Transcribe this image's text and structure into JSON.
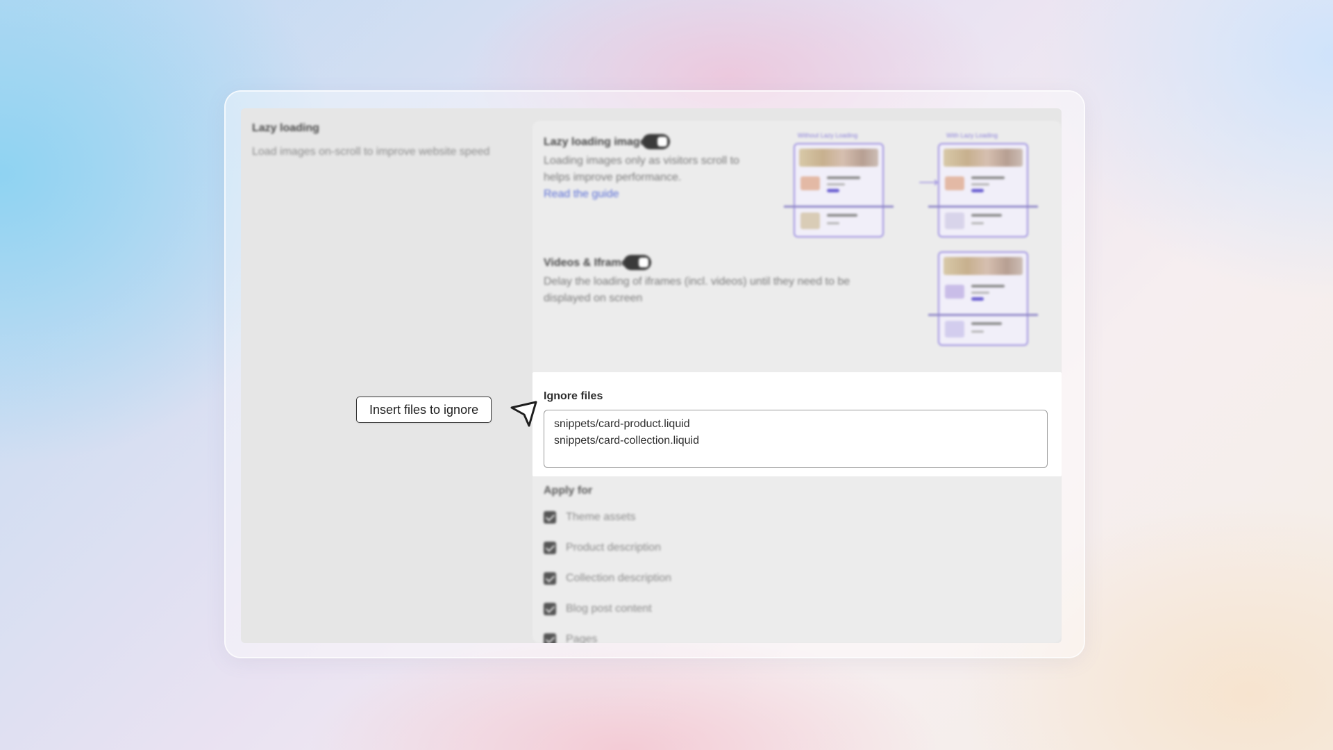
{
  "section": {
    "title": "Lazy loading",
    "description": "Load images on-scroll to improve website speed"
  },
  "lazy_images": {
    "title": "Lazy loading images",
    "enabled": true,
    "description_line1": "Loading images only as visitors scroll to",
    "description_line2": "helps improve performance.",
    "link": "Read the guide",
    "illustration_before": "Without Lazy Loading",
    "illustration_after": "With Lazy Loading"
  },
  "videos": {
    "title": "Videos & Iframes",
    "enabled": true,
    "description_line1": "Delay the loading of iframes (incl. videos) until they need to be",
    "description_line2": "displayed on screen"
  },
  "ignore_files": {
    "label": "Ignore files",
    "value": "snippets/card-product.liquid\nsnippets/card-collection.liquid"
  },
  "apply_for": {
    "title": "Apply for",
    "options": [
      {
        "label": "Theme assets",
        "checked": true
      },
      {
        "label": "Product description",
        "checked": true
      },
      {
        "label": "Collection description",
        "checked": true
      },
      {
        "label": "Blog post content",
        "checked": true
      },
      {
        "label": "Pages",
        "checked": true
      }
    ]
  },
  "callout": {
    "text": "Insert files to ignore"
  },
  "icons": {
    "cursor": "cursor-arrow-icon",
    "flow_arrow": "arrow-right-icon"
  },
  "colors": {
    "link": "#5b6fd6",
    "illustration_accent": "#9d90e0",
    "toggle_on": "#3a3a3a"
  }
}
